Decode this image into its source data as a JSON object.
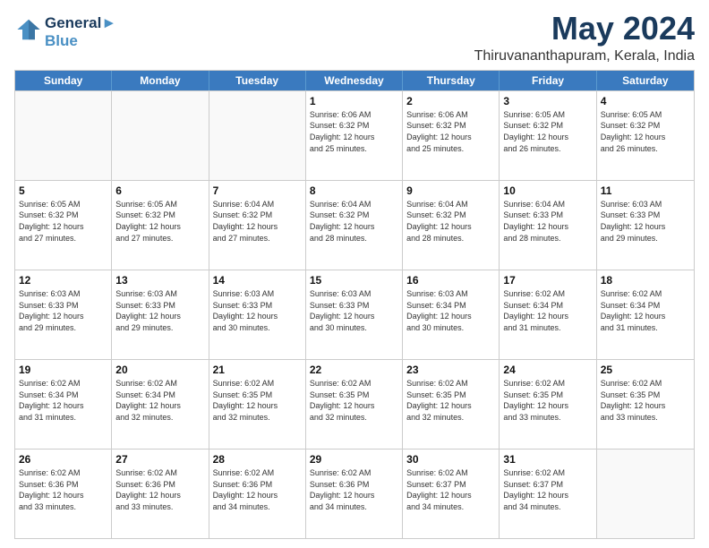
{
  "logo": {
    "line1": "General",
    "line2": "Blue"
  },
  "title": "May 2024",
  "location": "Thiruvananthapuram, Kerala, India",
  "days_of_week": [
    "Sunday",
    "Monday",
    "Tuesday",
    "Wednesday",
    "Thursday",
    "Friday",
    "Saturday"
  ],
  "weeks": [
    [
      {
        "day": "",
        "info": ""
      },
      {
        "day": "",
        "info": ""
      },
      {
        "day": "",
        "info": ""
      },
      {
        "day": "1",
        "info": "Sunrise: 6:06 AM\nSunset: 6:32 PM\nDaylight: 12 hours\nand 25 minutes."
      },
      {
        "day": "2",
        "info": "Sunrise: 6:06 AM\nSunset: 6:32 PM\nDaylight: 12 hours\nand 25 minutes."
      },
      {
        "day": "3",
        "info": "Sunrise: 6:05 AM\nSunset: 6:32 PM\nDaylight: 12 hours\nand 26 minutes."
      },
      {
        "day": "4",
        "info": "Sunrise: 6:05 AM\nSunset: 6:32 PM\nDaylight: 12 hours\nand 26 minutes."
      }
    ],
    [
      {
        "day": "5",
        "info": "Sunrise: 6:05 AM\nSunset: 6:32 PM\nDaylight: 12 hours\nand 27 minutes."
      },
      {
        "day": "6",
        "info": "Sunrise: 6:05 AM\nSunset: 6:32 PM\nDaylight: 12 hours\nand 27 minutes."
      },
      {
        "day": "7",
        "info": "Sunrise: 6:04 AM\nSunset: 6:32 PM\nDaylight: 12 hours\nand 27 minutes."
      },
      {
        "day": "8",
        "info": "Sunrise: 6:04 AM\nSunset: 6:32 PM\nDaylight: 12 hours\nand 28 minutes."
      },
      {
        "day": "9",
        "info": "Sunrise: 6:04 AM\nSunset: 6:32 PM\nDaylight: 12 hours\nand 28 minutes."
      },
      {
        "day": "10",
        "info": "Sunrise: 6:04 AM\nSunset: 6:33 PM\nDaylight: 12 hours\nand 28 minutes."
      },
      {
        "day": "11",
        "info": "Sunrise: 6:03 AM\nSunset: 6:33 PM\nDaylight: 12 hours\nand 29 minutes."
      }
    ],
    [
      {
        "day": "12",
        "info": "Sunrise: 6:03 AM\nSunset: 6:33 PM\nDaylight: 12 hours\nand 29 minutes."
      },
      {
        "day": "13",
        "info": "Sunrise: 6:03 AM\nSunset: 6:33 PM\nDaylight: 12 hours\nand 29 minutes."
      },
      {
        "day": "14",
        "info": "Sunrise: 6:03 AM\nSunset: 6:33 PM\nDaylight: 12 hours\nand 30 minutes."
      },
      {
        "day": "15",
        "info": "Sunrise: 6:03 AM\nSunset: 6:33 PM\nDaylight: 12 hours\nand 30 minutes."
      },
      {
        "day": "16",
        "info": "Sunrise: 6:03 AM\nSunset: 6:34 PM\nDaylight: 12 hours\nand 30 minutes."
      },
      {
        "day": "17",
        "info": "Sunrise: 6:02 AM\nSunset: 6:34 PM\nDaylight: 12 hours\nand 31 minutes."
      },
      {
        "day": "18",
        "info": "Sunrise: 6:02 AM\nSunset: 6:34 PM\nDaylight: 12 hours\nand 31 minutes."
      }
    ],
    [
      {
        "day": "19",
        "info": "Sunrise: 6:02 AM\nSunset: 6:34 PM\nDaylight: 12 hours\nand 31 minutes."
      },
      {
        "day": "20",
        "info": "Sunrise: 6:02 AM\nSunset: 6:34 PM\nDaylight: 12 hours\nand 32 minutes."
      },
      {
        "day": "21",
        "info": "Sunrise: 6:02 AM\nSunset: 6:35 PM\nDaylight: 12 hours\nand 32 minutes."
      },
      {
        "day": "22",
        "info": "Sunrise: 6:02 AM\nSunset: 6:35 PM\nDaylight: 12 hours\nand 32 minutes."
      },
      {
        "day": "23",
        "info": "Sunrise: 6:02 AM\nSunset: 6:35 PM\nDaylight: 12 hours\nand 32 minutes."
      },
      {
        "day": "24",
        "info": "Sunrise: 6:02 AM\nSunset: 6:35 PM\nDaylight: 12 hours\nand 33 minutes."
      },
      {
        "day": "25",
        "info": "Sunrise: 6:02 AM\nSunset: 6:35 PM\nDaylight: 12 hours\nand 33 minutes."
      }
    ],
    [
      {
        "day": "26",
        "info": "Sunrise: 6:02 AM\nSunset: 6:36 PM\nDaylight: 12 hours\nand 33 minutes."
      },
      {
        "day": "27",
        "info": "Sunrise: 6:02 AM\nSunset: 6:36 PM\nDaylight: 12 hours\nand 33 minutes."
      },
      {
        "day": "28",
        "info": "Sunrise: 6:02 AM\nSunset: 6:36 PM\nDaylight: 12 hours\nand 34 minutes."
      },
      {
        "day": "29",
        "info": "Sunrise: 6:02 AM\nSunset: 6:36 PM\nDaylight: 12 hours\nand 34 minutes."
      },
      {
        "day": "30",
        "info": "Sunrise: 6:02 AM\nSunset: 6:37 PM\nDaylight: 12 hours\nand 34 minutes."
      },
      {
        "day": "31",
        "info": "Sunrise: 6:02 AM\nSunset: 6:37 PM\nDaylight: 12 hours\nand 34 minutes."
      },
      {
        "day": "",
        "info": ""
      }
    ]
  ]
}
